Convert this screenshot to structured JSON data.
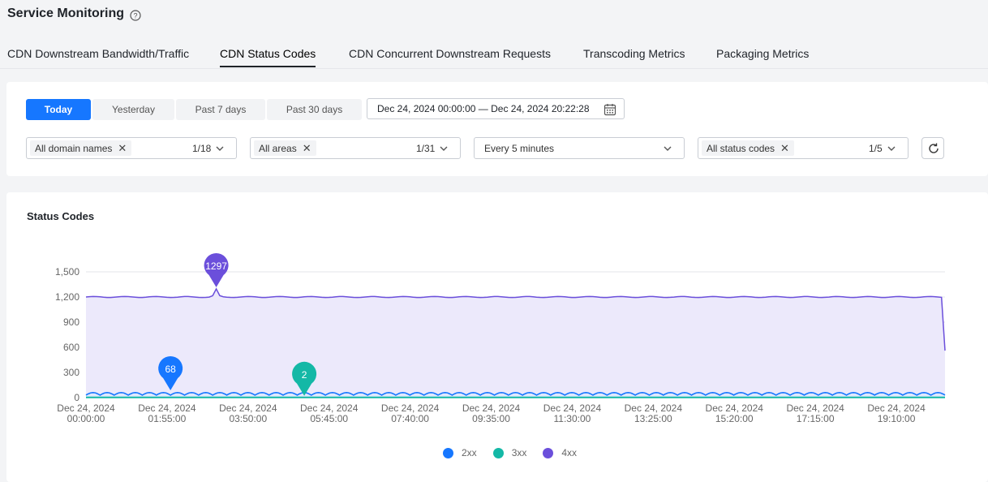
{
  "header": {
    "title": "Service Monitoring",
    "tabs": [
      {
        "label": "CDN Downstream Bandwidth/Traffic",
        "active": false
      },
      {
        "label": "CDN Status Codes",
        "active": true
      },
      {
        "label": "CDN Concurrent Downstream Requests",
        "active": false
      },
      {
        "label": "Transcoding Metrics",
        "active": false
      },
      {
        "label": "Packaging Metrics",
        "active": false
      }
    ]
  },
  "filters": {
    "quick_ranges": [
      {
        "label": "Today",
        "active": true
      },
      {
        "label": "Yesterday",
        "active": false
      },
      {
        "label": "Past 7 days",
        "active": false
      },
      {
        "label": "Past 30 days",
        "active": false
      }
    ],
    "date_range": "Dec 24, 2024 00:00:00 — Dec 24, 2024 20:22:28",
    "domain_select": {
      "tag": "All domain names",
      "count": "1/18"
    },
    "area_select": {
      "tag": "All areas",
      "count": "1/31"
    },
    "interval_select": {
      "value": "Every 5 minutes"
    },
    "status_select": {
      "tag": "All status codes",
      "count": "1/5"
    }
  },
  "chart_panel": {
    "title": "Status Codes"
  },
  "colors": {
    "accent": "#1677ff",
    "2xx": "#1677ff",
    "3xx": "#14b8a6",
    "4xx": "#6b4fdb"
  },
  "chart_data": {
    "type": "area",
    "title": "Status Codes",
    "ylim": [
      0,
      1500
    ],
    "yticks": [
      "0",
      "300",
      "600",
      "900",
      "1,200",
      "1,500"
    ],
    "xticks": [
      [
        "Dec 24, 2024",
        "00:00:00"
      ],
      [
        "Dec 24, 2024",
        "01:55:00"
      ],
      [
        "Dec 24, 2024",
        "03:50:00"
      ],
      [
        "Dec 24, 2024",
        "05:45:00"
      ],
      [
        "Dec 24, 2024",
        "07:40:00"
      ],
      [
        "Dec 24, 2024",
        "09:35:00"
      ],
      [
        "Dec 24, 2024",
        "11:30:00"
      ],
      [
        "Dec 24, 2024",
        "13:25:00"
      ],
      [
        "Dec 24, 2024",
        "15:20:00"
      ],
      [
        "Dec 24, 2024",
        "17:15:00"
      ],
      [
        "Dec 24, 2024",
        "19:10:00"
      ]
    ],
    "x_range_minutes": [
      0,
      1220
    ],
    "series": [
      {
        "name": "2xx",
        "baseline": 30,
        "oscillation": 30,
        "period_minutes": 20,
        "max_marker": {
          "minute": 120,
          "value": 68,
          "label": "68"
        }
      },
      {
        "name": "3xx",
        "baseline": 1,
        "oscillation": 1,
        "period_minutes": 20,
        "max_marker": {
          "minute": 310,
          "value": 2,
          "label": "2"
        }
      },
      {
        "name": "4xx",
        "baseline": 1200,
        "oscillation": 6,
        "spike": {
          "minute": 185,
          "value": 1297
        },
        "end_value": 560,
        "max_marker": {
          "minute": 185,
          "value": 1297,
          "label": "1297"
        }
      }
    ],
    "legend": [
      "2xx",
      "3xx",
      "4xx"
    ],
    "legend_position": "bottom-center",
    "grid": true
  }
}
